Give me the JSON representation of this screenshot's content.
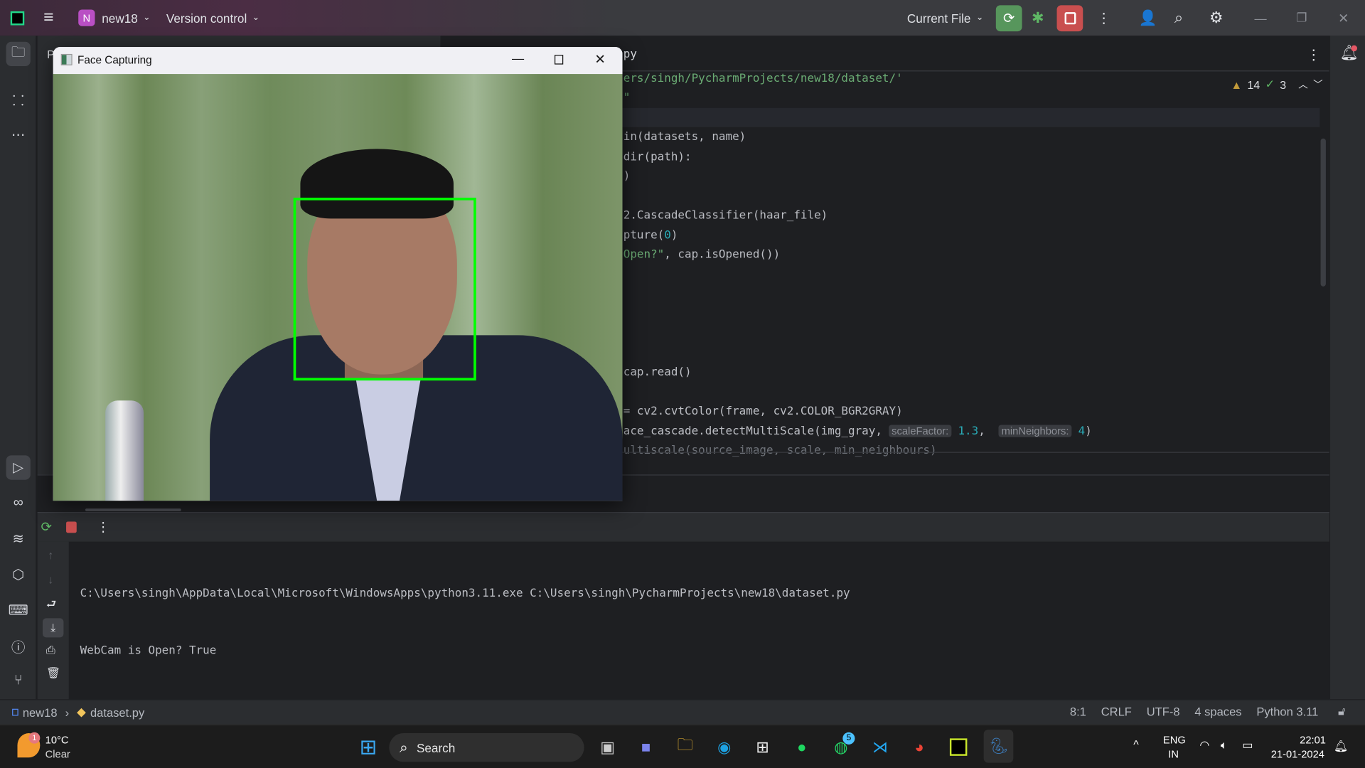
{
  "titlebar": {
    "project_initial": "N",
    "project_name": "new18",
    "vcs": "Version control",
    "run_config": "Current File"
  },
  "colors": {
    "accent_green": "#57965c",
    "stop_red": "#c94f4f",
    "project_badge": "#b94fc4",
    "face_box": "#00ff00"
  },
  "project_panel": {
    "title_initial": "P",
    "run_title_initial": "R"
  },
  "editor": {
    "tab_suffix": "py",
    "warnings": "14",
    "ok": "3",
    "lines": [
      {
        "i": 0,
        "parts": [
          {
            "t": "ers/singh/PycharmProjects/new18/dataset/'",
            "c": "str"
          }
        ]
      },
      {
        "i": 1,
        "parts": [
          {
            "t": "\"",
            "c": "str"
          }
        ]
      },
      {
        "i": 3,
        "parts": [
          {
            "t": "in(datasets, name)"
          }
        ]
      },
      {
        "i": 4,
        "parts": [
          {
            "t": "dir(path):"
          }
        ]
      },
      {
        "i": 5,
        "parts": [
          {
            "t": ")"
          }
        ]
      },
      {
        "i": 7,
        "parts": [
          {
            "t": "2.CascadeClassifier(haar_file)"
          }
        ]
      },
      {
        "i": 8,
        "parts": [
          {
            "t": "pture("
          },
          {
            "t": "0",
            "c": "num"
          },
          {
            "t": ")"
          }
        ]
      },
      {
        "i": 9,
        "parts": [
          {
            "t": "Open?\"",
            "c": "str"
          },
          {
            "t": ", cap.isOpened())"
          }
        ]
      },
      {
        "i": 15,
        "parts": [
          {
            "t": "cap.read()"
          }
        ]
      },
      {
        "i": 17,
        "parts": [
          {
            "t": "= cv2.cvtColor(frame, cv2.COLOR_BGR2GRAY)"
          }
        ]
      },
      {
        "i": 18,
        "parts": [
          {
            "t": "ace_cascade.detectMultiScale(img_gray, "
          },
          {
            "t": "scaleFactor:",
            "c": "hint"
          },
          {
            "t": " "
          },
          {
            "t": "1.3",
            "c": "num"
          },
          {
            "t": ",  "
          },
          {
            "t": "minNeighbors:",
            "c": "hint"
          },
          {
            "t": " "
          },
          {
            "t": "4",
            "c": "num"
          },
          {
            "t": ")"
          }
        ]
      },
      {
        "i": 19,
        "parts": [
          {
            "t": "ultiscale(source_image, scale, min_neighbours)",
            "c": "dim"
          }
        ]
      }
    ]
  },
  "run": {
    "output": [
      "C:\\Users\\singh\\AppData\\Local\\Microsoft\\WindowsApps\\python3.11.exe C:\\Users\\singh\\PycharmProjects\\new18\\dataset.py",
      "WebCam is Open? True"
    ]
  },
  "face_window": {
    "title": "Face Capturing"
  },
  "statusbar": {
    "project": "new18",
    "file": "dataset.py",
    "position": "8:1",
    "line_sep": "CRLF",
    "encoding": "UTF-8",
    "indent": "4 spaces",
    "interpreter": "Python 3.11"
  },
  "taskbar": {
    "temp": "10°C",
    "weather": "Clear",
    "weather_badge": "1",
    "search": "Search",
    "whatsapp_badge": "5",
    "lang1": "ENG",
    "lang2": "IN",
    "time": "22:01",
    "date": "21-01-2024"
  }
}
